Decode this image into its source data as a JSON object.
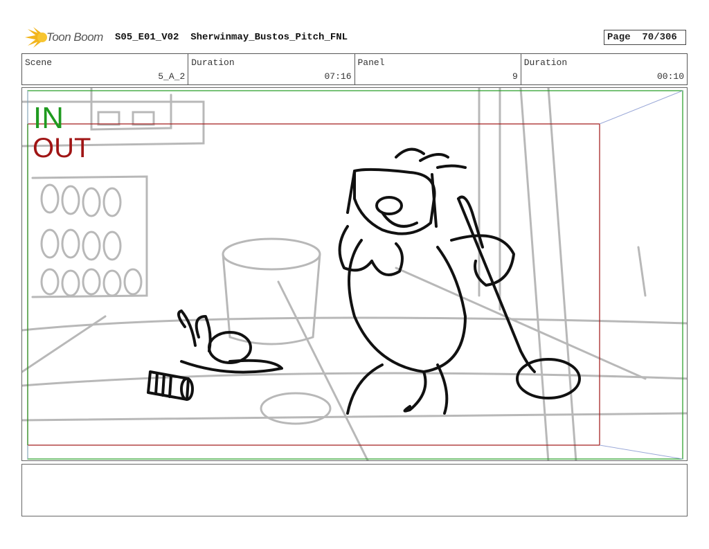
{
  "header": {
    "logo_text": "Toon Boom",
    "title": "S05_E01_V02  Sherwinmay_Bustos_Pitch_FNL",
    "page_label": "Page  70/306"
  },
  "info": {
    "scene_label": "Scene",
    "scene_value": "5_A_2",
    "duration_label": "Duration",
    "duration_value": "07:16",
    "panel_label": "Panel",
    "panel_value": "9",
    "panel_duration_label": "Duration",
    "panel_duration_value": "00:10"
  },
  "panel": {
    "in_label": "IN",
    "out_label": "OUT",
    "in_color": "#1f9a1f",
    "out_color": "#a01515"
  },
  "notes": {
    "text": ""
  }
}
